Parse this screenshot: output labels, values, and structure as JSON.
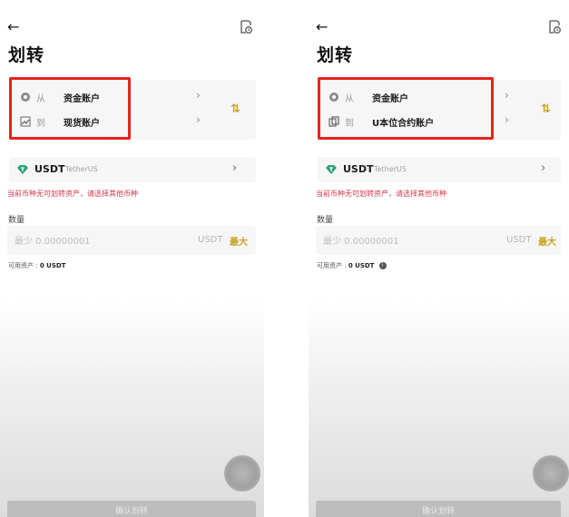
{
  "panels": [
    {
      "title": "划转",
      "from_label": "从",
      "from_account": "资金账户",
      "to_label": "到",
      "to_account": "现货账户",
      "coin_symbol": "USDT",
      "coin_name": "TetherUS",
      "warning": "当前币种无可划转资产，请选择其他币种",
      "quantity_label": "数量",
      "quantity_placeholder": "最少 0.00000001",
      "quantity_unit": "USDT",
      "max_label": "最大",
      "available_label": "可用资产 :",
      "available_value": "0 USDT",
      "confirm_label": "确认划转"
    },
    {
      "title": "划转",
      "from_label": "从",
      "from_account": "资金账户",
      "to_label": "到",
      "to_account": "U本位合约账户",
      "coin_symbol": "USDT",
      "coin_name": "TetherUS",
      "warning": "当前币种无可划转资产，请选择其他币种",
      "quantity_label": "数量",
      "quantity_placeholder": "最少 0.00000001",
      "quantity_unit": "USDT",
      "max_label": "最大",
      "available_label": "可用资产 :",
      "available_value": "0 USDT",
      "confirm_label": "确认划转"
    }
  ],
  "icons": {
    "back": "arrow-left-icon",
    "history": "history-icon",
    "swap": "swap-icon",
    "coin": "tether-icon",
    "info": "info-icon"
  },
  "colors": {
    "accent": "#c9a227",
    "highlight": "#e8211c",
    "warning": "#d9364a",
    "coin": "#26a17b"
  }
}
